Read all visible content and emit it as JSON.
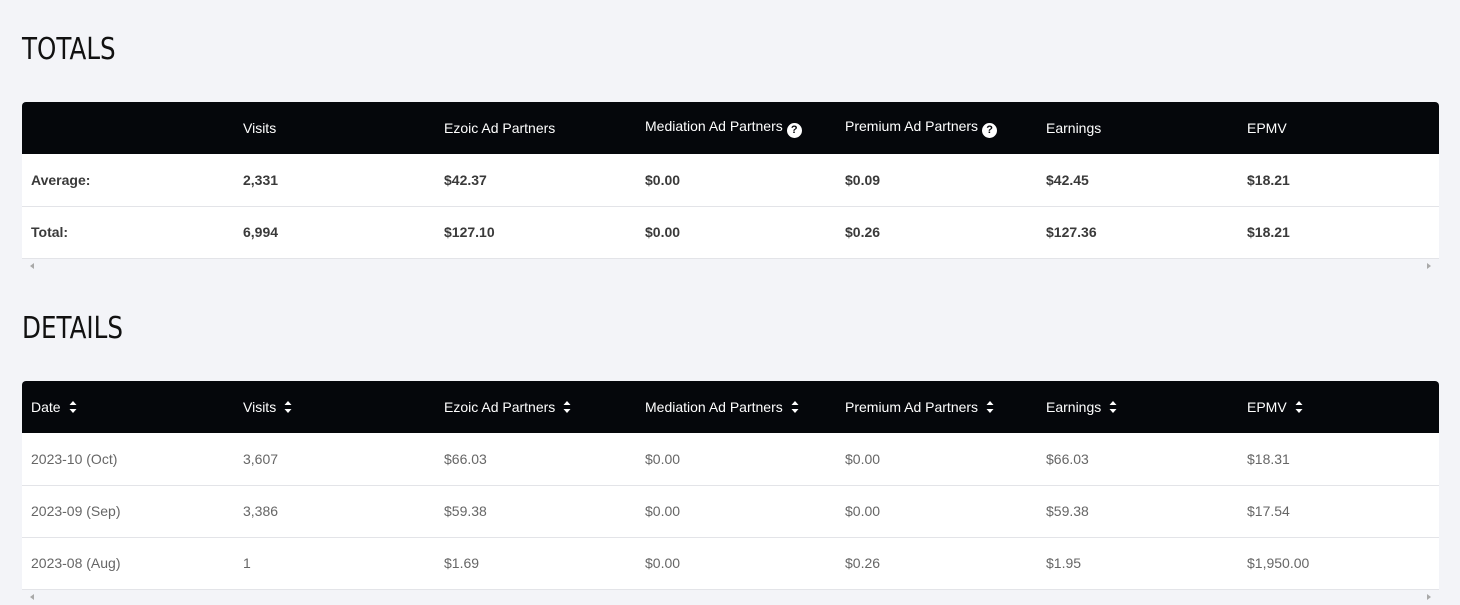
{
  "totals": {
    "title": "TOTALS",
    "columns": [
      "",
      "Visits",
      "Ezoic Ad Partners",
      "Mediation Ad Partners",
      "Premium Ad Partners",
      "Earnings",
      "EPMV"
    ],
    "rows": [
      [
        "Average:",
        "2,331",
        "$42.37",
        "$0.00",
        "$0.09",
        "$42.45",
        "$18.21"
      ],
      [
        "Total:",
        "6,994",
        "$127.10",
        "$0.00",
        "$0.26",
        "$127.36",
        "$18.21"
      ]
    ],
    "help_icon": "question-circle-icon"
  },
  "details": {
    "title": "DETAILS",
    "columns": [
      "Date",
      "Visits",
      "Ezoic Ad Partners",
      "Mediation Ad Partners",
      "Premium Ad Partners",
      "Earnings",
      "EPMV"
    ],
    "rows": [
      [
        "2023-10 (Oct)",
        "3,607",
        "$66.03",
        "$0.00",
        "$0.00",
        "$66.03",
        "$18.31"
      ],
      [
        "2023-09 (Sep)",
        "3,386",
        "$59.38",
        "$0.00",
        "$0.00",
        "$59.38",
        "$17.54"
      ],
      [
        "2023-08 (Aug)",
        "1",
        "$1.69",
        "$0.00",
        "$0.26",
        "$1.95",
        "$1,950.00"
      ]
    ],
    "sort_icon": "sort-icon"
  },
  "colors": {
    "header_bg": "#05070b",
    "page_bg": "#f3f4f8",
    "row_bg": "#ffffff"
  }
}
